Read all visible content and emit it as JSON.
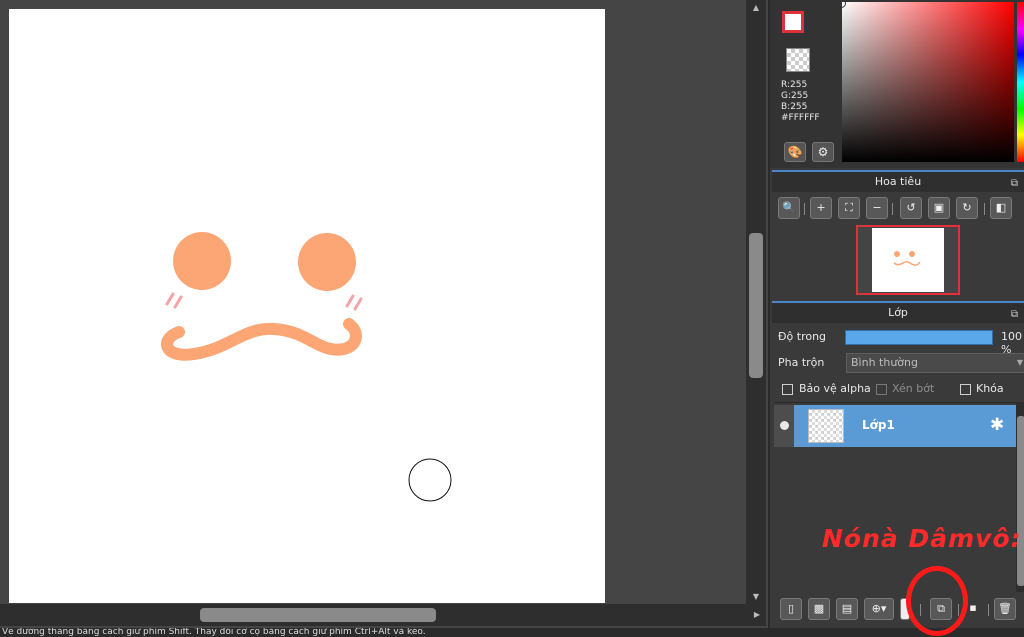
{
  "status_bar": {
    "text": "Vẽ đường thẳng bằng cách giữ phím Shift. Thay đổi cỡ cọ bằng cách giữ phím Ctrl+Alt và kéo."
  },
  "color": {
    "r": "R:255",
    "g": "G:255",
    "b": "B:255",
    "hex": "#FFFFFF",
    "fg_color": "#FFFFFF",
    "accent": "#e0303a"
  },
  "navigator": {
    "title": "Hoa tiêu"
  },
  "layers": {
    "title": "Lớp",
    "opacity_label": "Độ trong",
    "opacity_value": "100 %",
    "opacity": 100,
    "blend_label": "Pha trộn",
    "blend_value": "Bình thường",
    "protect_alpha": "Bảo vệ alpha",
    "clipping": "Xén bớt",
    "lock": "Khóa",
    "items": [
      {
        "name": "Lớp1",
        "selected": true,
        "visible": true
      }
    ]
  },
  "annotation": {
    "text": "Nónà Dâmvô:"
  },
  "drawing": {
    "fill_color": "#fba674",
    "blush_color": "#f4a3a8"
  }
}
